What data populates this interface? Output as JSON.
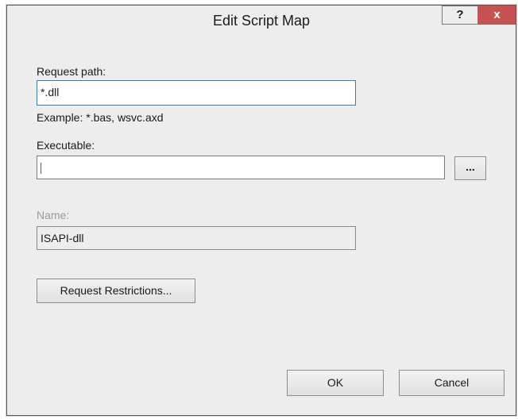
{
  "dialog": {
    "title": "Edit Script Map",
    "help_label": "?",
    "close_label": "x"
  },
  "request_path": {
    "label": "Request path:",
    "value": "*.dll",
    "example": "Example: *.bas, wsvc.axd"
  },
  "executable": {
    "label": "Executable:",
    "value": "",
    "browse_label": "..."
  },
  "name": {
    "label": "Name:",
    "value": "ISAPI-dll"
  },
  "buttons": {
    "request_restrictions": "Request Restrictions...",
    "ok": "OK",
    "cancel": "Cancel"
  }
}
